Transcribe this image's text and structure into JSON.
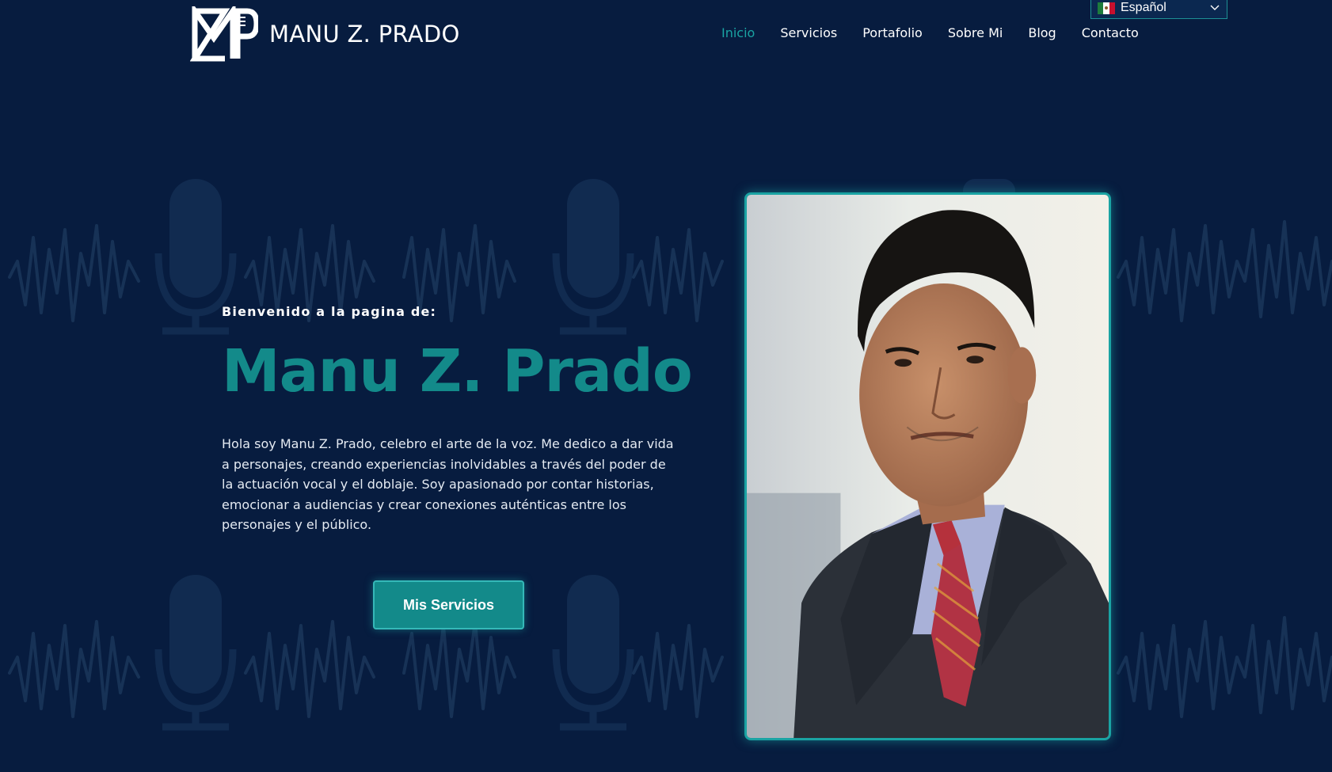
{
  "brand": {
    "name": "MANU Z. PRADO",
    "logo_icon": "mzp-monogram-icon"
  },
  "nav": {
    "items": [
      {
        "label": "Inicio",
        "active": true
      },
      {
        "label": "Servicios",
        "active": false
      },
      {
        "label": "Portafolio",
        "active": false
      },
      {
        "label": "Sobre Mi",
        "active": false
      },
      {
        "label": "Blog",
        "active": false
      },
      {
        "label": "Contacto",
        "active": false
      }
    ]
  },
  "language": {
    "selected": "Español",
    "flag_icon": "mexico-flag-icon"
  },
  "hero": {
    "welcome": "Bienvenido a la pagina de:",
    "title": "Manu Z. Prado",
    "description": "Hola soy Manu Z. Prado, celebro el arte de la voz. Me dedico a dar vida a personajes, creando experiencias inolvidables a través del poder de la actuación vocal y el doblaje. Soy apasionado por contar historias, emocionar a audiencias y crear conexiones auténticas entre los personajes y el público.",
    "cta_label": "Mis Servicios"
  },
  "colors": {
    "background": "#071c3f",
    "accent": "#138a8a",
    "accent_light": "#1aa3a3",
    "text": "#ffffff"
  }
}
